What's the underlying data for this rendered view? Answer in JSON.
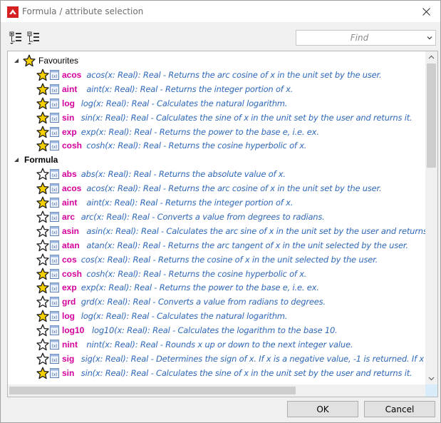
{
  "window": {
    "title": "Formula / attribute selection"
  },
  "toolbar": {
    "find_placeholder": "Find"
  },
  "tree": {
    "groups": [
      {
        "label": "Favourites",
        "expanded": true,
        "items": [
          {
            "name": "acos",
            "desc": "acos(x: Real): Real - Returns the arc cosine of x in the unit set by the user.",
            "favourite": true
          },
          {
            "name": "aint",
            "desc": "aint(x: Real): Real - Returns the integer portion of x.",
            "favourite": true
          },
          {
            "name": "log",
            "desc": "log(x: Real): Real - Calculates the natural logarithm.",
            "favourite": true
          },
          {
            "name": "sin",
            "desc": "sin(x: Real): Real - Calculates the sine of x in the unit set by the user and returns it.",
            "favourite": true
          },
          {
            "name": "exp",
            "desc": "exp(x: Real): Real - Returns the power to the base e, i.e. ex.",
            "favourite": true
          },
          {
            "name": "cosh",
            "desc": "cosh(x: Real): Real - Returns the cosine hyperbolic of x.",
            "favourite": true
          }
        ]
      },
      {
        "label": "Formula",
        "expanded": true,
        "items": [
          {
            "name": "abs",
            "desc": "abs(x: Real): Real - Returns the absolute value of x.",
            "favourite": false
          },
          {
            "name": "acos",
            "desc": "acos(x: Real): Real - Returns the arc cosine of x in the unit set by the user.",
            "favourite": true
          },
          {
            "name": "aint",
            "desc": "aint(x: Real): Real - Returns the integer portion of x.",
            "favourite": true
          },
          {
            "name": "arc",
            "desc": "arc(x: Real): Real - Converts a value from degrees to radians.",
            "favourite": false
          },
          {
            "name": "asin",
            "desc": "asin(x: Real): Real - Calculates the arc sine of x in the unit set by the user and returns it.",
            "favourite": false
          },
          {
            "name": "atan",
            "desc": "atan(x: Real): Real - Returns the arc tangent of x in the unit selected by the user.",
            "favourite": false
          },
          {
            "name": "cos",
            "desc": "cos(x: Real): Real - Returns the cosine of x in the unit selected by the user.",
            "favourite": false
          },
          {
            "name": "cosh",
            "desc": "cosh(x: Real): Real - Returns the cosine hyperbolic of x.",
            "favourite": true
          },
          {
            "name": "exp",
            "desc": "exp(x: Real): Real - Returns the power to the base e, i.e. ex.",
            "favourite": true
          },
          {
            "name": "grd",
            "desc": "grd(x: Real): Real - Converts a value from radians to degrees.",
            "favourite": false
          },
          {
            "name": "log",
            "desc": "log(x: Real): Real - Calculates the natural logarithm.",
            "favourite": true
          },
          {
            "name": "log10",
            "desc": "log10(x: Real): Real - Calculates the logarithm to the base 10.",
            "favourite": false
          },
          {
            "name": "nint",
            "desc": "nint(x: Real): Real - Rounds x up or down to the next integer value.",
            "favourite": false
          },
          {
            "name": "sig",
            "desc": "sig(x: Real): Real - Determines the sign of x. If x is a negative value, -1 is returned. If x is a positi",
            "favourite": false
          },
          {
            "name": "sin",
            "desc": "sin(x: Real): Real - Calculates the sine of x in the unit set by the user and returns it.",
            "favourite": true
          }
        ]
      }
    ]
  },
  "buttons": {
    "ok": "OK",
    "cancel": "Cancel"
  },
  "colors": {
    "function_name": "#d4009c",
    "description": "#2f68b8",
    "star_fill": "#f5d000"
  }
}
